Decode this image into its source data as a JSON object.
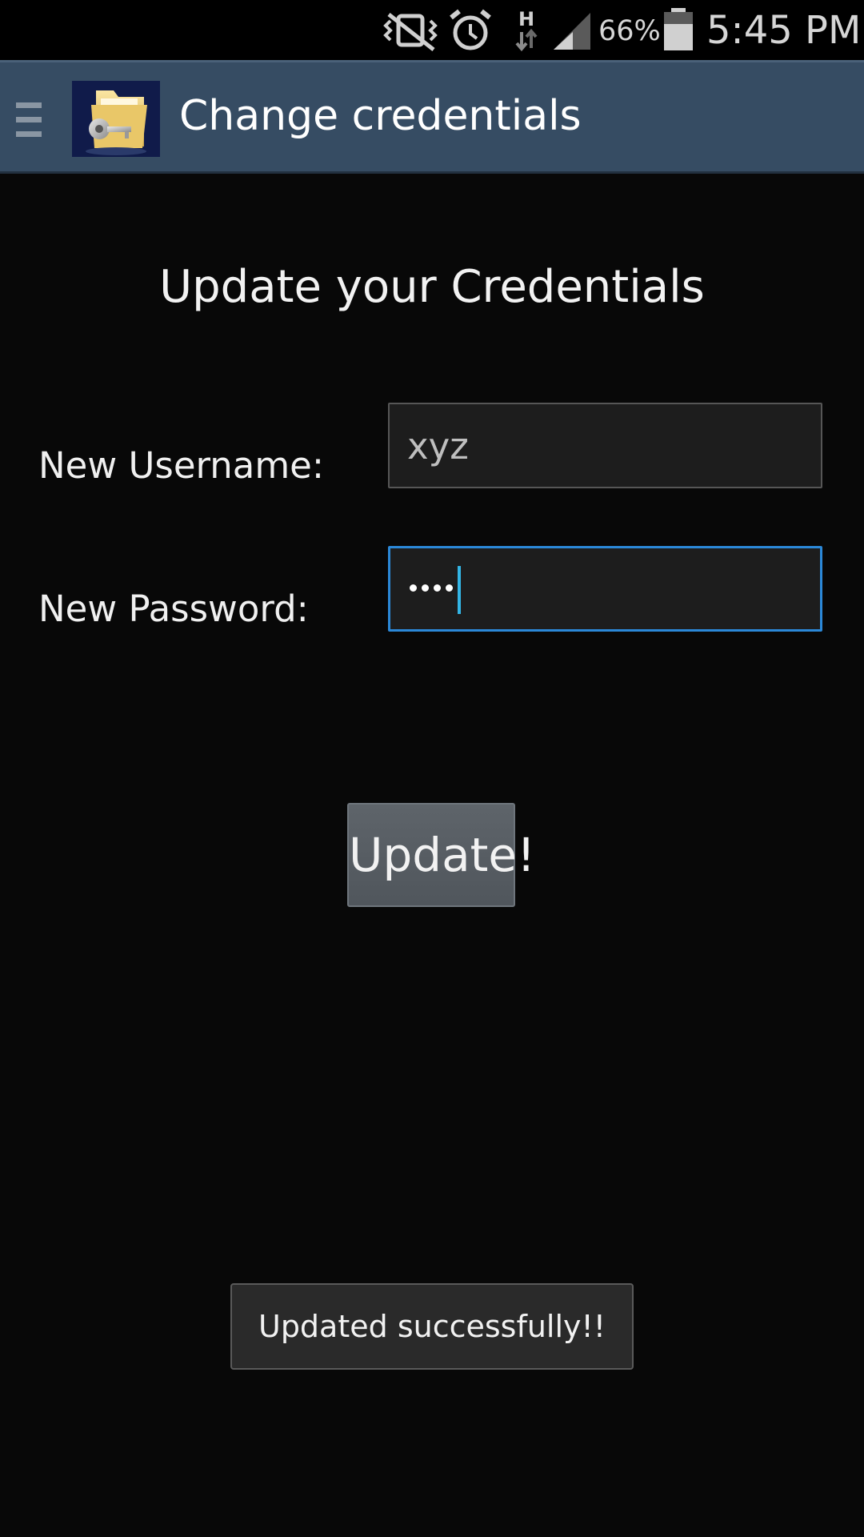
{
  "status_bar": {
    "battery_percent": "66%",
    "time": "5:45 PM",
    "network_type": "H",
    "icons": [
      "vibrate-icon",
      "alarm-icon",
      "data-transfer-icon",
      "signal-icon",
      "battery-icon"
    ]
  },
  "action_bar": {
    "title": "Change credentials",
    "menu_icon": "drawer-menu-icon",
    "app_icon": "folder-lock-app-icon",
    "background_color": "#364c63"
  },
  "form": {
    "heading": "Update your Credentials",
    "username_label": "New Username:",
    "username_value": "xyz",
    "password_label": "New Password:",
    "password_masked_length": 4,
    "focused_field": "password",
    "focus_color": "#2b88d8",
    "submit_label": "Update!"
  },
  "toast": {
    "message": "Updated successfully!!"
  }
}
